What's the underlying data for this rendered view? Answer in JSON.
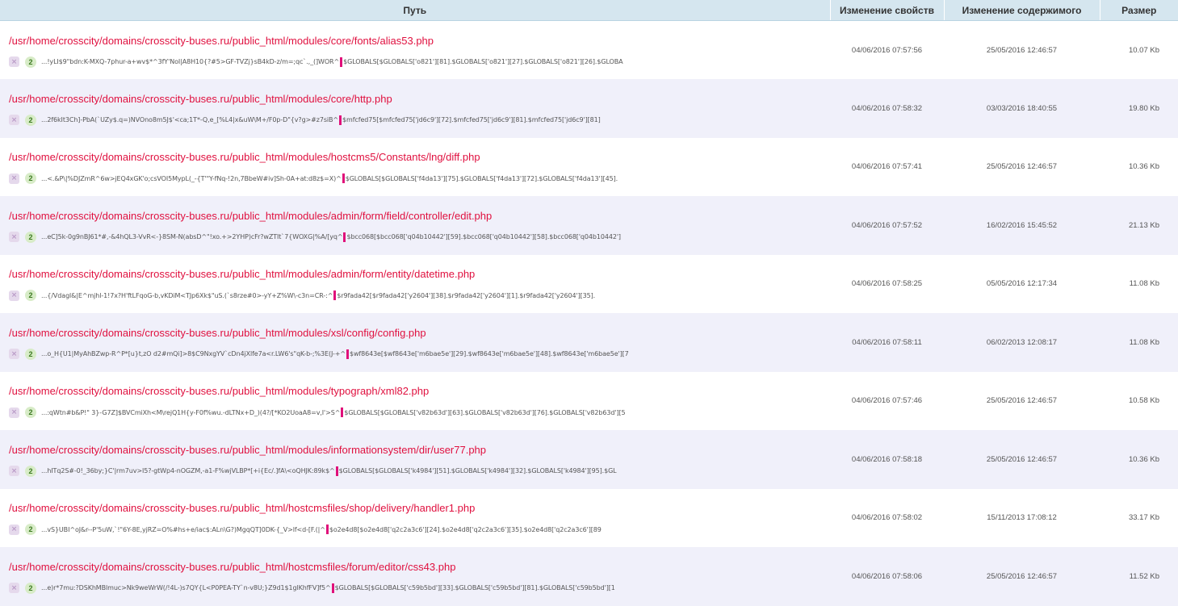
{
  "header": {
    "path": "Путь",
    "props_changed": "Изменение свойств",
    "content_changed": "Изменение содержимого",
    "size": "Размер"
  },
  "icons": {
    "delete": "delete-x-icon",
    "count": "count-badge"
  },
  "colors": {
    "path": "#e0103f",
    "header_bg": "#d5e6ef",
    "alt_row": "#f0f0fa",
    "marker": "#e0107a"
  },
  "rows": [
    {
      "path": "/usr/home/crosscity/domains/crosscity-buses.ru/public_html/modules/core/fonts/alias53.php",
      "count": "2",
      "before": "...!yLI$9\"bdn:K-MXQ-7phur-a+wv$*^3fY'NoI|A8H10{?#5>GF-TVZj}sB4kD-z/m=;qc`.,_(]WOR^",
      "after": "$GLOBALS[$GLOBALS['o821'][81].$GLOBALS['o821'][27].$GLOBALS['o821'][26].$GLOBA",
      "props": "04/06/2016 07:57:56",
      "content": "25/05/2016 12:46:57",
      "size": "10.07 Kb"
    },
    {
      "path": "/usr/home/crosscity/domains/crosscity-buses.ru/public_html/modules/core/http.php",
      "count": "2",
      "before": "...2f6kIt3Ch]-PbA(`UZy$.q=)NVOno8m5J$'<ca;1T*-Q,e_[%L4|x&uW\\M+/F0p-D\"{v?g>#z7siB^",
      "after": "$mfcfed75[$mfcfed75['jd6c9'][72].$mfcfed75['jd6c9'][81].$mfcfed75['jd6c9'][81]",
      "props": "04/06/2016 07:58:32",
      "content": "03/03/2016 18:40:55",
      "size": "19.80 Kb"
    },
    {
      "path": "/usr/home/crosscity/domains/crosscity-buses.ru/public_html/modules/hostcms5/Constants/lng/diff.php",
      "count": "2",
      "before": "...<.&P\\|%DJZmR^6w>jEQ4xGK'o;csVOI5MypL(_-{T'\"Y-fNq-!2n,7BbeW#iv]Sh-0A+at:d8z$=X)^",
      "after": "$GLOBALS[$GLOBALS['f4da13'][75].$GLOBALS['f4da13'][72].$GLOBALS['f4da13'][45].",
      "props": "04/06/2016 07:57:41",
      "content": "25/05/2016 12:46:57",
      "size": "10.36 Kb"
    },
    {
      "path": "/usr/home/crosscity/domains/crosscity-buses.ru/public_html/modules/admin/form/field/controller/edit.php",
      "count": "2",
      "before": "...eC]5k-0g9nBJ61*#,-&4hQL3-VvR<-}8SM-N(absD^\"!xo.+>2YHP)cFr?wZTIt`7{WOXG|%A/[yq^",
      "after": "$bcc068[$bcc068['q04b10442'][59].$bcc068['q04b10442'][58].$bcc068['q04b10442']",
      "props": "04/06/2016 07:57:52",
      "content": "16/02/2016 15:45:52",
      "size": "21.13 Kb"
    },
    {
      "path": "/usr/home/crosscity/domains/crosscity-buses.ru/public_html/modules/admin/form/entity/datetime.php",
      "count": "2",
      "before": "...{/Vdagl&|E^mjhl-1!7x?H'ftLFqoG-b,vKDiM<TJp6Xk$\"uS.(`s8rze#0>-yY+Z%W\\-c3n=CR-:^",
      "after": "$r9fada42[$r9fada42['y2604'][38].$r9fada42['y2604'][1].$r9fada42['y2604'][35].",
      "props": "04/06/2016 07:58:25",
      "content": "05/05/2016 12:17:34",
      "size": "11.08 Kb"
    },
    {
      "path": "/usr/home/crosscity/domains/crosscity-buses.ru/public_html/modules/xsl/config/config.php",
      "count": "2",
      "before": "...o_H{U1|MyAhBZwp-R^P*[u}t,zO d2#mQi]>8$C9NxgYV`cDn4jXlfe7a<r.LW6's\"qK-b-;%3E(J-+^",
      "after": "$wf8643e[$wf8643e['m6bae5e'][29].$wf8643e['m6bae5e'][48].$wf8643e['m6bae5e'][7",
      "props": "04/06/2016 07:58:11",
      "content": "06/02/2013 12:08:17",
      "size": "11.08 Kb"
    },
    {
      "path": "/usr/home/crosscity/domains/crosscity-buses.ru/public_html/modules/typograph/xml82.php",
      "count": "2",
      "before": "...:qWtn#b&P!\" 3}-G7Z]$BVCmiXh<M\\rejQ1H{y-F0f%wu.-dLTNx+D_)(4?/[*KO2UoaA8=v,I'>S^",
      "after": "$GLOBALS[$GLOBALS['v82b63d'][63].$GLOBALS['v82b63d'][76].$GLOBALS['v82b63d'][5",
      "props": "04/06/2016 07:57:46",
      "content": "25/05/2016 12:46:57",
      "size": "10.58 Kb"
    },
    {
      "path": "/usr/home/crosscity/domains/crosscity-buses.ru/public_html/modules/informationsystem/dir/user77.php",
      "count": "2",
      "before": "...hITq2S#-0!_36by;}C'|rm7uv>I5?-gtWp4-nOGZM,-a1-F%wjVLBP*[+i{Ec/.]fA\\<oQHJK:89k$^",
      "after": "$GLOBALS[$GLOBALS['k4984'][51].$GLOBALS['k4984'][32].$GLOBALS['k4984'][95].$GL",
      "props": "04/06/2016 07:58:18",
      "content": "25/05/2016 12:46:57",
      "size": "10.36 Kb"
    },
    {
      "path": "/usr/home/crosscity/domains/crosscity-buses.ru/public_html/hostcmsfiles/shop/delivery/handler1.php",
      "count": "2",
      "before": "...vS}UBI^oJ&r--P'5uW,`!\"6Y-8E,yjRZ=O%#hs+e/iac$:ALn\\G?)MgqQT]0DK-{_V>lf<d-[F.(|^",
      "after": "$o2e4d8[$o2e4d8['q2c2a3c6'][24].$o2e4d8['q2c2a3c6'][35].$o2e4d8['q2c2a3c6'][89",
      "props": "04/06/2016 07:58:02",
      "content": "15/11/2013 17:08:12",
      "size": "33.17 Kb"
    },
    {
      "path": "/usr/home/crosscity/domains/crosscity-buses.ru/public_html/hostcmsfiles/forum/editor/css43.php",
      "count": "2",
      "before": "...e)r*7mu:?DSKhMBlmuc>Nk9weWrW(/!4L-)s7QY{L<P0PEA-TY`n-v8U;}Z9d1$1glKhfFV]f5^",
      "after": "$GLOBALS[$GLOBALS['c59b5bd'][33].$GLOBALS['c59b5bd'][81].$GLOBALS['c59b5bd'][1",
      "props": "04/06/2016 07:58:06",
      "content": "25/05/2016 12:46:57",
      "size": "11.52 Kb"
    }
  ]
}
